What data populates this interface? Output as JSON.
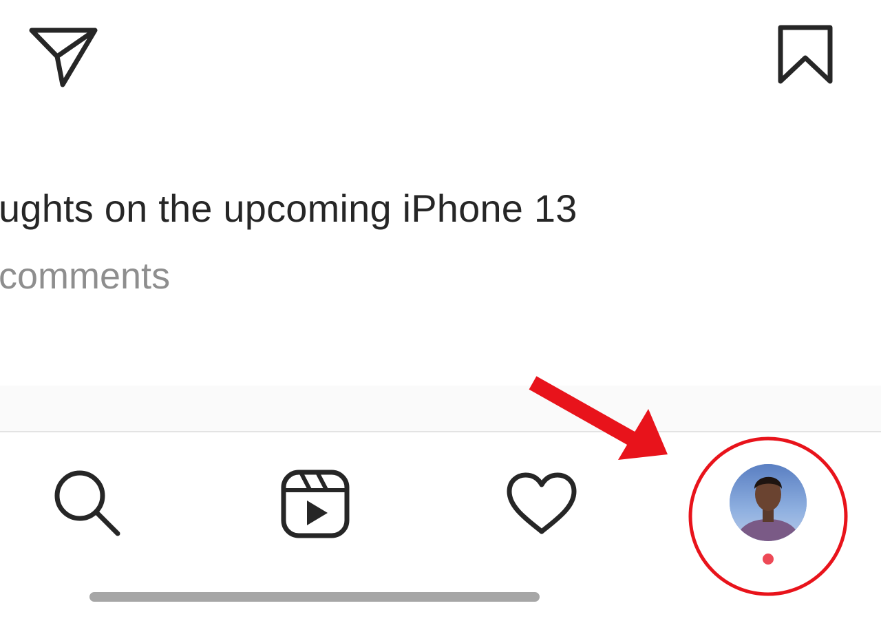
{
  "post": {
    "caption_fragment": "ughts on the upcoming iPhone 13",
    "comments_fragment": "comments",
    "actions": {
      "share_icon": "paper-plane-icon",
      "save_icon": "bookmark-icon"
    }
  },
  "bottom_nav": {
    "items": [
      {
        "id": "search",
        "icon": "search-icon"
      },
      {
        "id": "reels",
        "icon": "reels-icon"
      },
      {
        "id": "activity",
        "icon": "heart-icon"
      },
      {
        "id": "profile",
        "icon": "avatar",
        "has_notification": true
      }
    ]
  },
  "annotation": {
    "highlight": "profile-tab",
    "color": "#e8131b"
  },
  "colors": {
    "text_primary": "#262626",
    "text_secondary": "#8e8e8e",
    "notification": "#ed4956"
  }
}
